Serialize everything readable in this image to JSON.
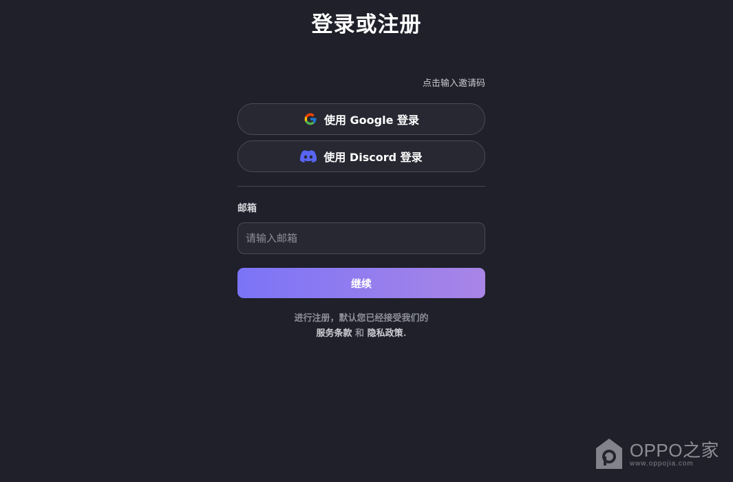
{
  "page": {
    "title": "登录或注册"
  },
  "invite": {
    "label": "点击输入邀请码"
  },
  "oauth": {
    "google_label": "使用 Google 登录",
    "google_icon": "google-logo-icon",
    "discord_label": "使用 Discord 登录",
    "discord_icon": "discord-logo-icon",
    "discord_color": "#5865F2"
  },
  "email": {
    "label": "邮箱",
    "placeholder": "请输入邮箱",
    "value": ""
  },
  "continue": {
    "label": "继续",
    "gradient_start": "#7b74f7",
    "gradient_end": "#a985e6"
  },
  "legal": {
    "prefix": "进行注册，默认您已经接受我们的",
    "terms_label": "服务条款",
    "conjunction": "和",
    "privacy_label": "隐私政策",
    "suffix": "."
  },
  "watermark": {
    "brand": "OPPO之家",
    "url": "www.oppojia.com"
  },
  "colors": {
    "background": "#1f2029",
    "surface": "#272832",
    "border": "#4a4b57"
  }
}
